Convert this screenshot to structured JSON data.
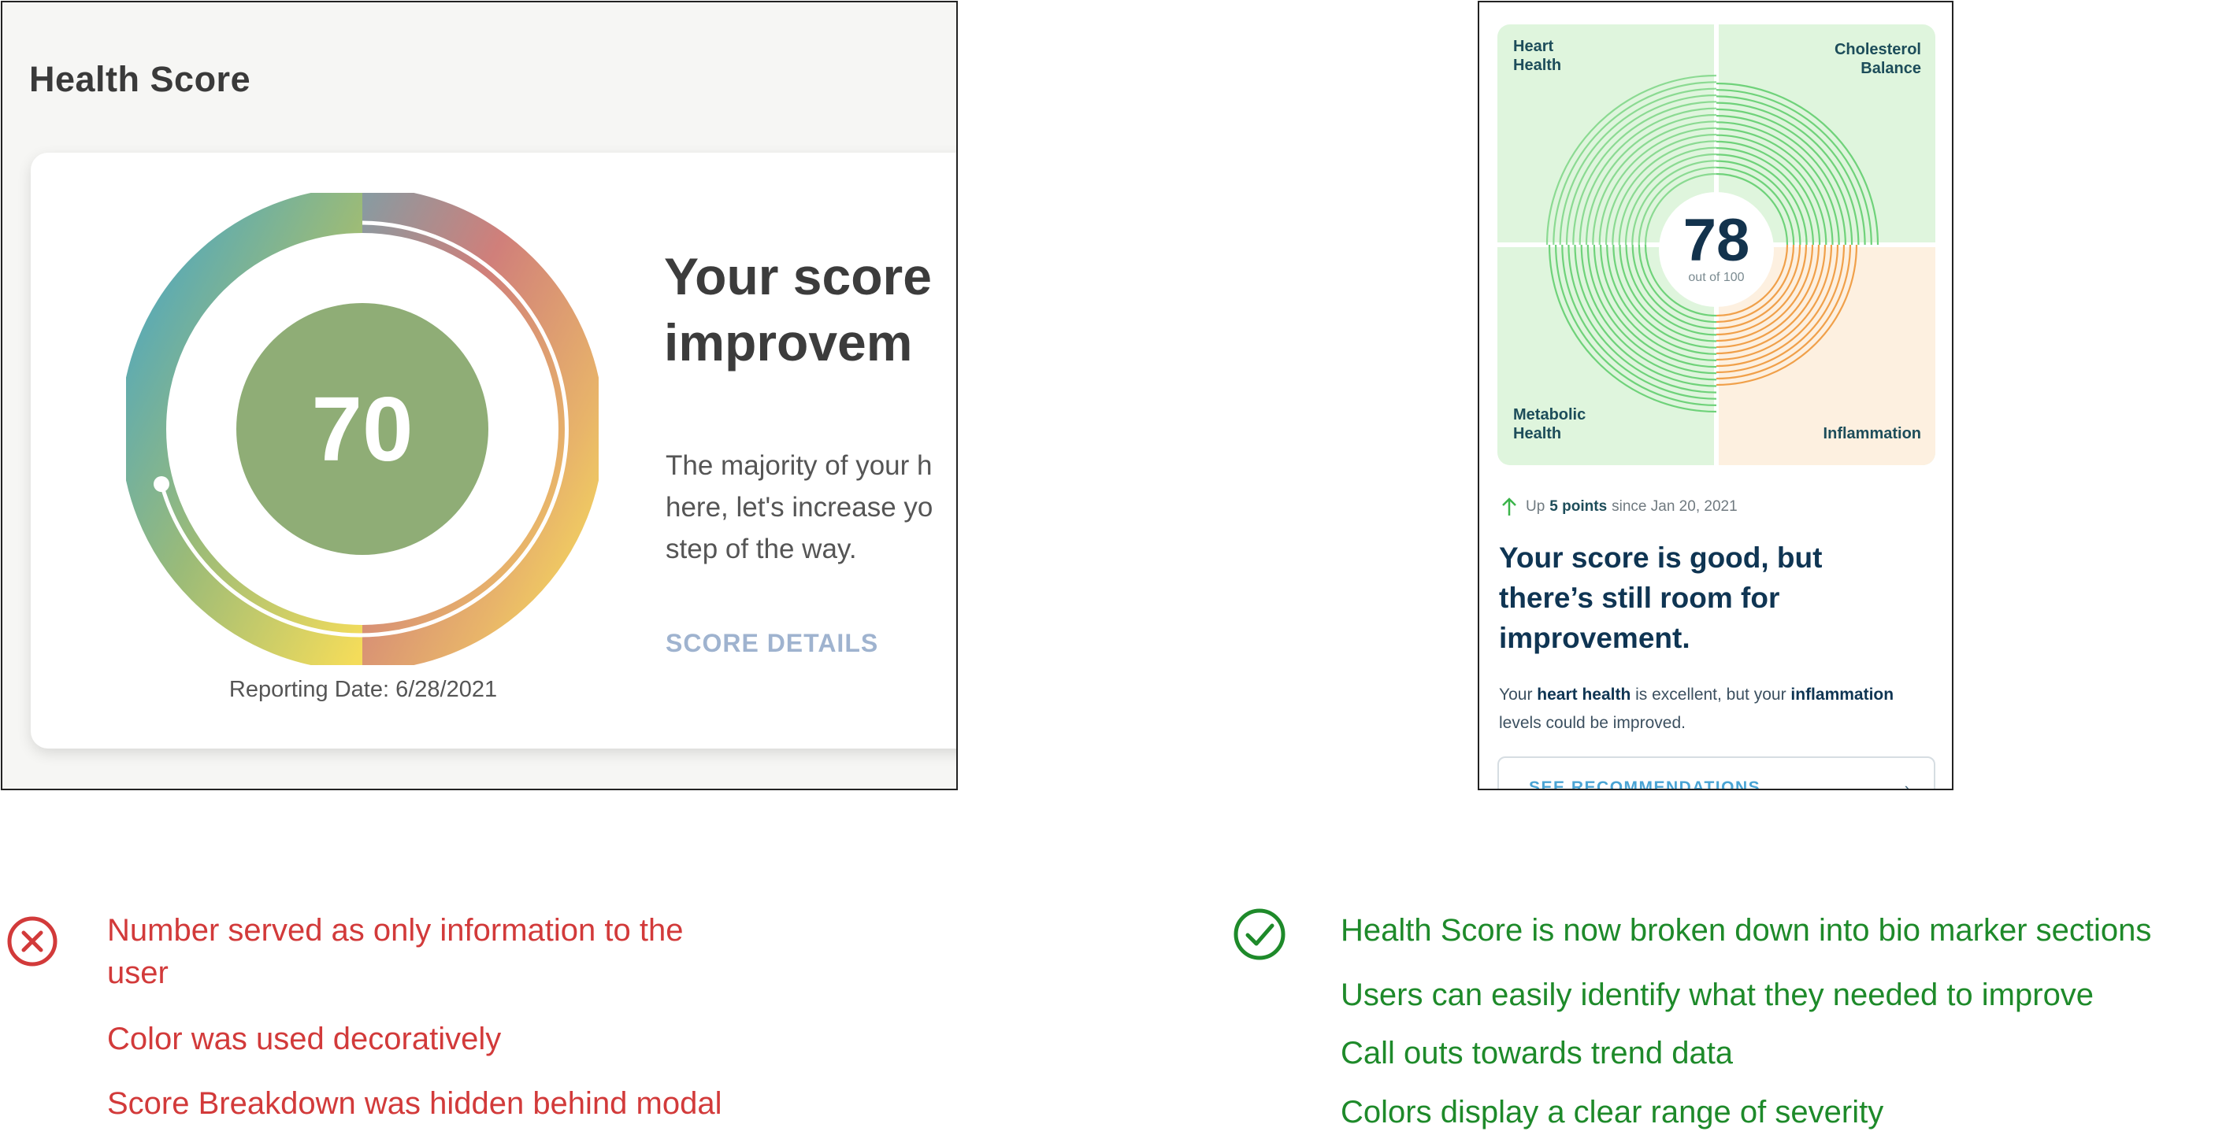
{
  "old_design": {
    "title": "Health Score",
    "score": "70",
    "report_date": "Reporting Date: 6/28/2021",
    "headline": "Your score\nimprovem",
    "body": "The majority of your h\nhere, let's increase yo\nstep of the way.",
    "details_link": "SCORE DETAILS"
  },
  "new_design": {
    "quadrants": {
      "top_left": "Heart\nHealth",
      "top_right": "Cholesterol\nBalance",
      "bottom_left": "Metabolic\nHealth",
      "bottom_right": "Inflammation"
    },
    "score": "78",
    "score_sub": "out of 100",
    "trend": {
      "prefix": "Up",
      "points": "5 points",
      "suffix": "since Jan 20, 2021"
    },
    "headline": "Your score is good, but\nthere’s still room for\nimprovement.",
    "body_parts": [
      "Your ",
      "heart health",
      " is excellent, but your ",
      "inflammation",
      " levels could be improved."
    ],
    "button_label": "SEE RECOMMENDATIONS"
  },
  "notes": {
    "bad_icon": "x-circle-icon",
    "good_icon": "check-circle-icon",
    "bad": [
      "Number served as only information to the\nuser",
      "Color was used decoratively",
      "Score Breakdown was hidden behind modal"
    ],
    "good": [
      "Health Score is now broken down into bio marker sections",
      "Users can easily identify what they needed to improve",
      "Call outs towards trend data",
      "Colors display a clear range of severity"
    ]
  },
  "colors": {
    "bad": "#d23a3a",
    "good": "#1e8a2a",
    "green_quad": "#dff5dd",
    "orange_quad": "#fdf0e0",
    "green_ring": "#6fd27a",
    "orange_ring": "#f0a04a",
    "old_score_fill": "#8fad76"
  }
}
